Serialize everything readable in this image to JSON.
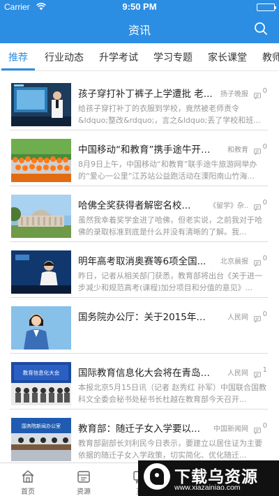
{
  "status": {
    "carrier": "Carrier",
    "time": "9:50 PM"
  },
  "nav": {
    "title": "资讯"
  },
  "tabs": [
    {
      "label": "推荐"
    },
    {
      "label": "行业动态"
    },
    {
      "label": "升学考试"
    },
    {
      "label": "学习专题"
    },
    {
      "label": "家长课堂"
    },
    {
      "label": "教师"
    }
  ],
  "news": [
    {
      "title": "孩子穿打补丁裤子上学遭批 老...",
      "source": "扬子晚报",
      "comments": "0",
      "summary": "给孩子穿打补丁的衣服到学校，竟然被老师责令 &ldquo;整改&rdquo;，言之&ldquo;丢了学校和班..."
    },
    {
      "title": "中国移动“和教育”携手途牛开启...",
      "source": "和教育",
      "comments": "0",
      "summary": "8月9日上午，中国移动“和教育”联手途牛旅游网举办的“爱心一公里”江苏站公益跑活动在溧阳南山竹海..."
    },
    {
      "title": "哈佛全奖获得者解密名校...",
      "source": "《留学》杂...",
      "comments": "0",
      "summary": "虽然我幸着奖学金进了哈佛，但老实说，之前我对于哈佛的录取标准到底是什么并没有清晰的了解。我..."
    },
    {
      "title": "明年高考取消奥赛等6项全国...",
      "source": "北京晨报",
      "comments": "0",
      "summary": "昨日，记者从相关部门获悉，教育部将出台《关于进一步减少和规范高考(课程)加分项目和分值的意见》..."
    },
    {
      "title": "国务院办公厅：关于2015年部...",
      "source": "人民网",
      "comments": "0",
      "summary": ""
    },
    {
      "title": "国际教育信息化大会将在青岛召开",
      "source": "人民网",
      "comments": "1",
      "summary": "本报北京5月15日讯（记者 赵秀红 孙军）中国联合国教科文全委会秘书处秘书长杜越在教育部今天召开..."
    },
    {
      "title": "教育部：随迁子女入学要以...",
      "source": "中国新闻网",
      "comments": "0",
      "summary": "教育部副部长刘利民今日表示，要建立以居住证为主要依据的随迁子女入学政策，切实简化、优化随迁..."
    }
  ],
  "thumb_texts": {
    "t6_banner": "教育信息化大会",
    "t7_banner": "国务院新闻办公室"
  },
  "tabbar": [
    {
      "label": "首页"
    },
    {
      "label": "资源"
    },
    {
      "label": "互"
    }
  ],
  "watermark": {
    "brand": "下载乌资源",
    "url": "www.xiazainiao.com"
  },
  "colors": {
    "accent": "#2c8ee3",
    "divider": "#dcdcdc",
    "muted": "#999999"
  }
}
